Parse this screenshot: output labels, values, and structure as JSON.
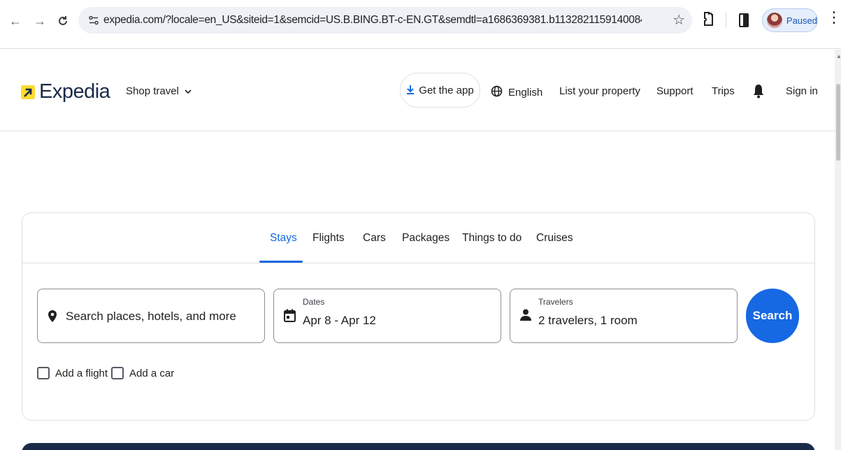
{
  "browser": {
    "url": "expedia.com/?locale=en_US&siteid=1&semcid=US.B.BING.BT-c-EN.GT&semdtl=a1686369381.b11328211591400846.g1kwd-830140619...",
    "profile_status": "Paused",
    "icons": [
      "back-arrow-icon",
      "forward-arrow-icon",
      "reload-icon",
      "site-info-icon",
      "star-icon",
      "extensions-icon",
      "side-panel-icon",
      "menu-icon"
    ]
  },
  "header": {
    "logo_text": "Expedia",
    "shop_travel_label": "Shop travel",
    "get_app_label": "Get the app",
    "language_label": "English",
    "list_property_label": "List your property",
    "support_label": "Support",
    "trips_label": "Trips",
    "sign_in_label": "Sign in"
  },
  "search_card": {
    "tabs": [
      {
        "label": "Stays",
        "active": true
      },
      {
        "label": "Flights",
        "active": false
      },
      {
        "label": "Cars",
        "active": false
      },
      {
        "label": "Packages",
        "active": false
      },
      {
        "label": "Things to do",
        "active": false
      },
      {
        "label": "Cruises",
        "active": false
      }
    ],
    "destination_placeholder": "Search places, hotels, and more",
    "dates_label": "Dates",
    "dates_value": "Apr 8 - Apr 12",
    "travelers_label": "Travelers",
    "travelers_value": "2 travelers, 1 room",
    "search_label": "Search",
    "add_flight_label": "Add a flight",
    "add_car_label": "Add a car"
  },
  "colors": {
    "accent": "#1668e3",
    "logo_yellow": "#fddb32",
    "brand_navy": "#1a2b49"
  }
}
